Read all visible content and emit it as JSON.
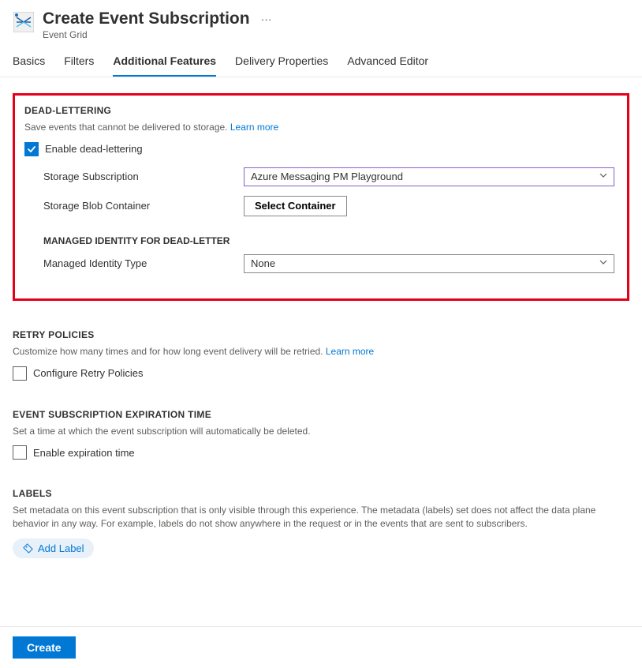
{
  "header": {
    "title": "Create Event Subscription",
    "subtitle": "Event Grid"
  },
  "tabs": {
    "basics": "Basics",
    "filters": "Filters",
    "additional_features": "Additional Features",
    "delivery_properties": "Delivery Properties",
    "advanced_editor": "Advanced Editor"
  },
  "dead_lettering": {
    "heading": "DEAD-LETTERING",
    "description": "Save events that cannot be delivered to storage. ",
    "learn_more": "Learn more",
    "enable_label": "Enable dead-lettering",
    "enable_checked": true,
    "storage_subscription_label": "Storage Subscription",
    "storage_subscription_value": "Azure Messaging PM Playground",
    "storage_blob_label": "Storage Blob Container",
    "select_container_btn": "Select Container",
    "managed_identity_heading": "MANAGED IDENTITY FOR DEAD-LETTER",
    "managed_identity_label": "Managed Identity Type",
    "managed_identity_value": "None"
  },
  "retry": {
    "heading": "RETRY POLICIES",
    "description": "Customize how many times and for how long event delivery will be retried. ",
    "learn_more": "Learn more",
    "configure_label": "Configure Retry Policies",
    "configure_checked": false
  },
  "expiration": {
    "heading": "EVENT SUBSCRIPTION EXPIRATION TIME",
    "description": "Set a time at which the event subscription will automatically be deleted.",
    "enable_label": "Enable expiration time",
    "enable_checked": false
  },
  "labels": {
    "heading": "LABELS",
    "description": "Set metadata on this event subscription that is only visible through this experience. The metadata (labels) set does not affect the data plane behavior in any way. For example, labels do not show anywhere in the request or in the events that are sent to subscribers.",
    "add_label_btn": "Add Label"
  },
  "footer": {
    "create_btn": "Create"
  }
}
